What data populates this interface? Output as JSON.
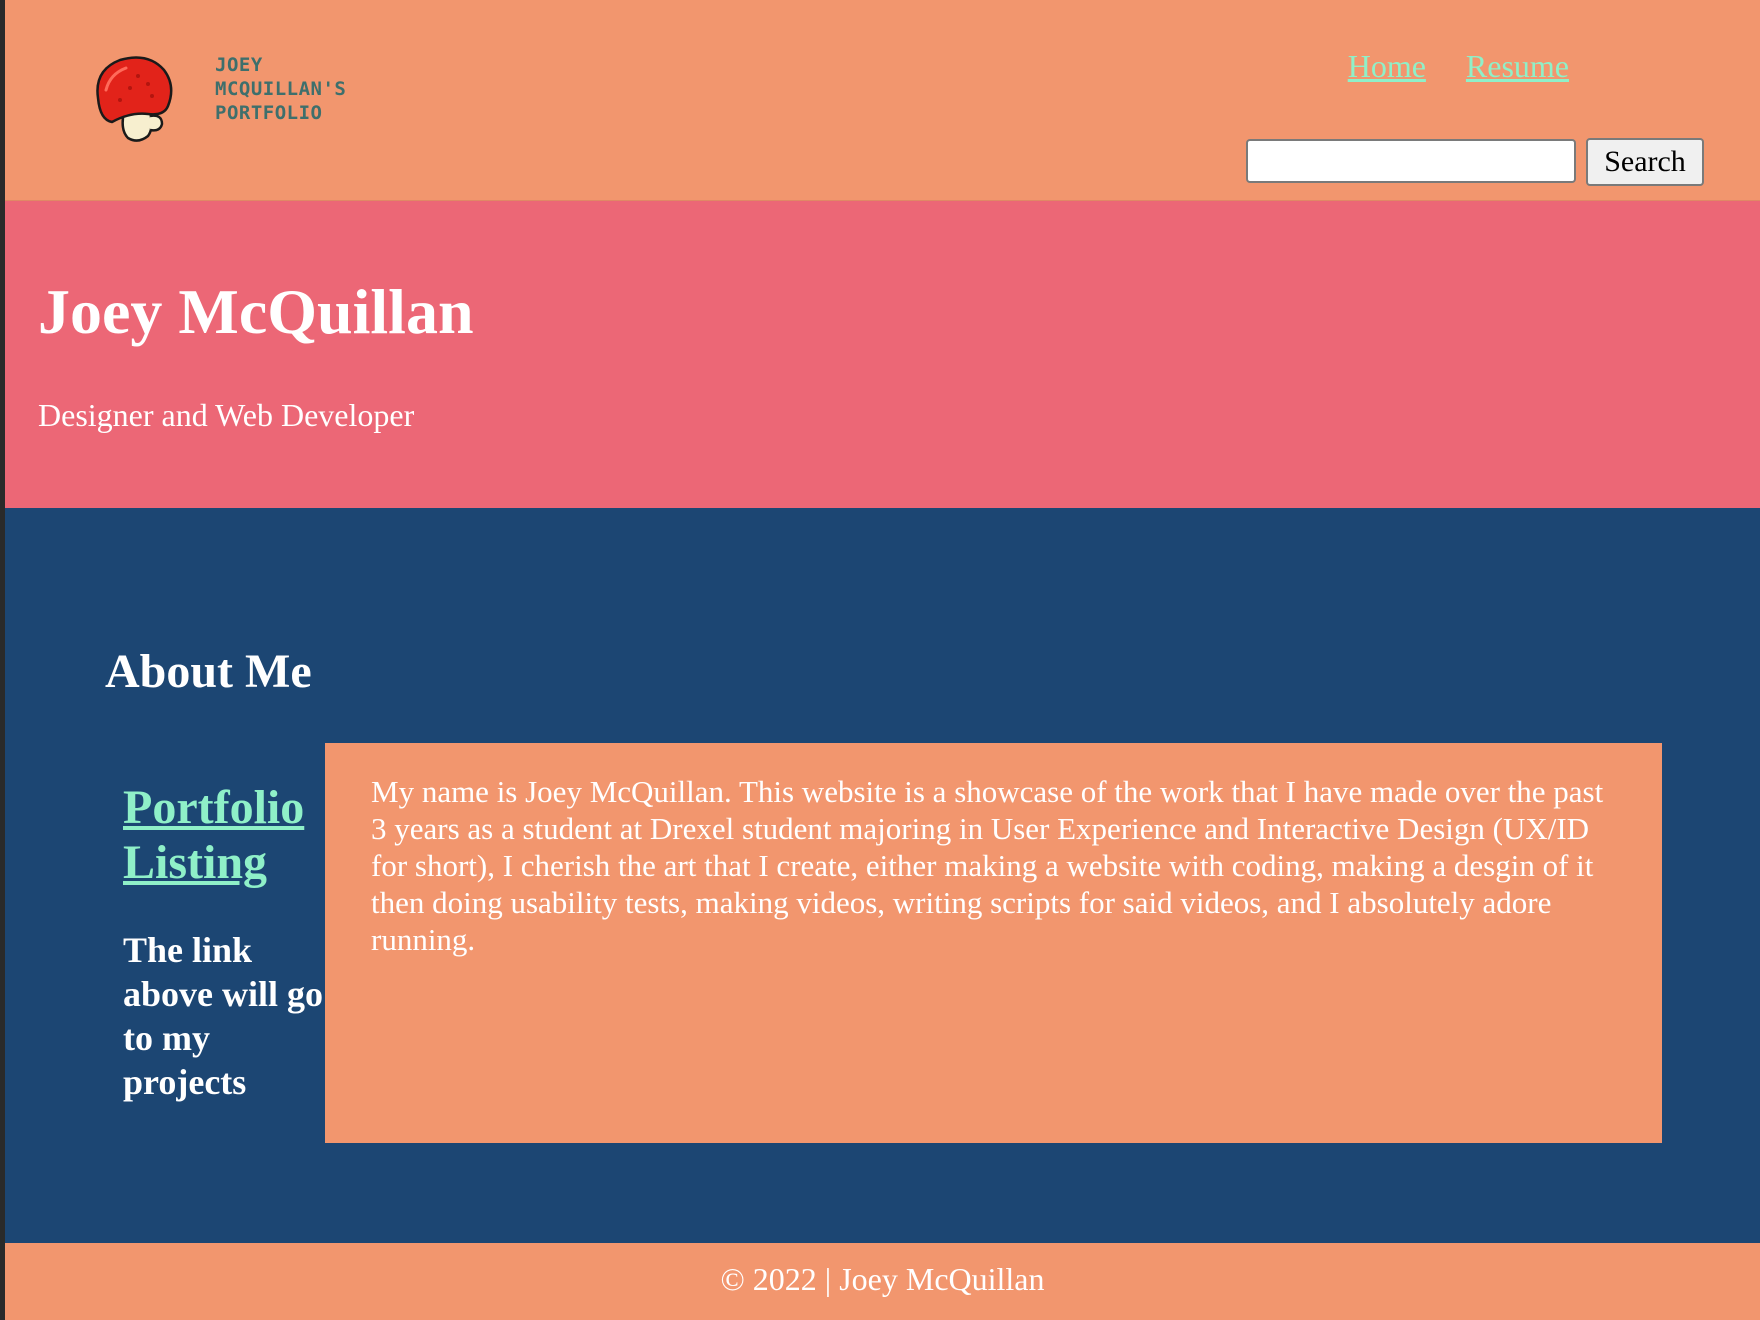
{
  "header": {
    "logo_icon": "mushroom-icon",
    "logo_lines": [
      "Joey",
      "McQuillan's",
      "Portfolio"
    ],
    "nav": [
      {
        "label": "Home"
      },
      {
        "label": "Resume"
      }
    ],
    "search": {
      "value": "",
      "placeholder": "",
      "button_label": "Search"
    }
  },
  "hero": {
    "title": "Joey McQuillan",
    "subtitle": "Designer and Web Developer"
  },
  "main": {
    "section_title": "About Me",
    "portfolio_link": "Portfolio Listing",
    "side_note": "The link above will go to my projects",
    "about_text": "My name is Joey McQuillan. This website is a showcase of the work that I have made over the past 3 years as a student at Drexel student majoring in User Experience and Interactive Design (UX/ID for short), I cherish the art that I create, either making a website with coding, making a desgin of it then doing usability tests, making videos, writing scripts for said videos, and I absolutely adore running."
  },
  "footer": {
    "text": "© 2022 | Joey McQuillan"
  },
  "colors": {
    "header_bg": "#f2966e",
    "hero_bg": "#ec6776",
    "main_bg": "#1c4673",
    "link": "#8ff0c8",
    "logo_text": "#3e6f6c"
  }
}
